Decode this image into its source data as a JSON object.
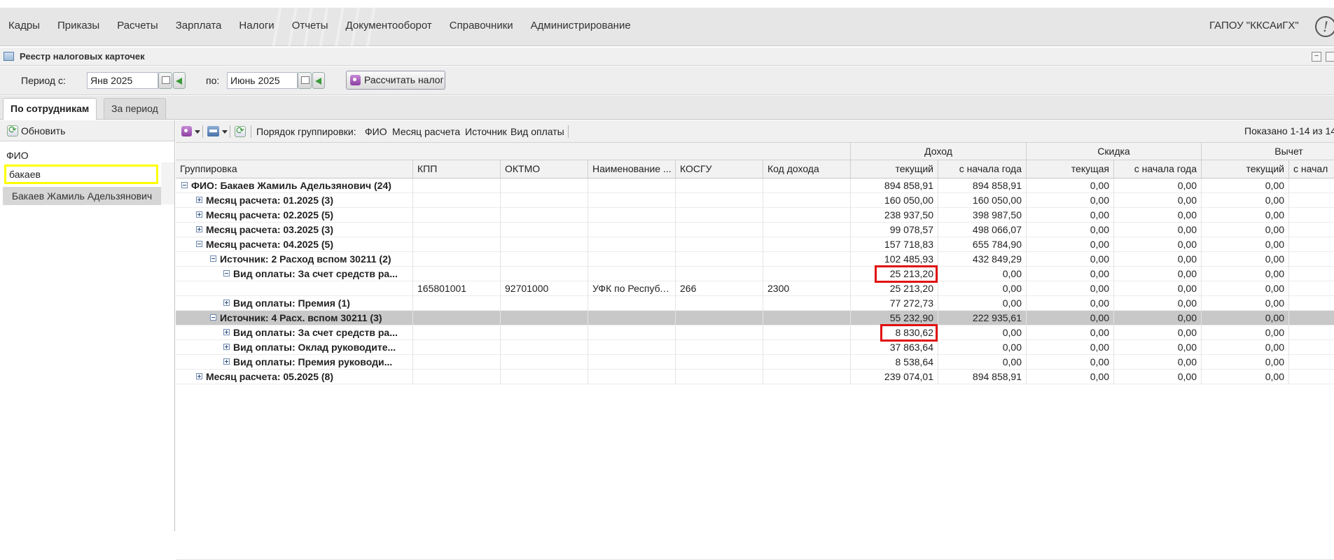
{
  "menu": [
    "Кадры",
    "Приказы",
    "Расчеты",
    "Зарплата",
    "Налоги",
    "Отчеты",
    "Документооборот",
    "Справочники",
    "Администрирование"
  ],
  "org_name": "ГАПОУ \"ККСАиГХ\"",
  "alert_icon": "!",
  "window": {
    "title": "Реестр налоговых карточек",
    "minimize": "–"
  },
  "period": {
    "from_label": "Период с:",
    "from_value": "Янв 2025",
    "to_label": "по:",
    "to_value": "Июнь 2025",
    "calc_button": "Рассчитать налог"
  },
  "tabs": [
    "По сотрудникам",
    "За период"
  ],
  "left": {
    "refresh_label": "Обновить",
    "fio_label": "ФИО",
    "search_value": "бакаев",
    "result": "Бакаев Жамиль Адельзянович"
  },
  "toolbar": {
    "grouping_label": "Порядок группировки:",
    "grouping_items": [
      "ФИО",
      "Месяц расчета",
      "Источник",
      "Вид оплаты"
    ],
    "shown": "Показано 1-14 из 14"
  },
  "header_groups": [
    "Доход",
    "Скидка",
    "Вычет"
  ],
  "columns": [
    "Группировка",
    "КПП",
    "ОКТМО",
    "Наименование ...",
    "КОСГУ",
    "Код дохода",
    "текущий",
    "с начала года",
    "текущая",
    "с начала года",
    "текущий",
    "с начал"
  ],
  "rows": [
    {
      "group": "ФИО: Бакаев Жамиль Адельзянович (24)",
      "level": 0,
      "expander": "minus",
      "bold": true,
      "kpp": "",
      "oktmo": "",
      "name": "",
      "kosgu": "",
      "code": "",
      "inc_cur": "894 858,91",
      "inc_ytd": "894 858,91",
      "disc_cur": "0,00",
      "disc_ytd": "0,00",
      "ded_cur": "0,00"
    },
    {
      "group": "Месяц расчета: 01.2025 (3)",
      "level": 1,
      "expander": "plus",
      "bold": true,
      "kpp": "",
      "oktmo": "",
      "name": "",
      "kosgu": "",
      "code": "",
      "inc_cur": "160 050,00",
      "inc_ytd": "160 050,00",
      "disc_cur": "0,00",
      "disc_ytd": "0,00",
      "ded_cur": "0,00"
    },
    {
      "group": "Месяц расчета: 02.2025 (5)",
      "level": 1,
      "expander": "plus",
      "bold": true,
      "kpp": "",
      "oktmo": "",
      "name": "",
      "kosgu": "",
      "code": "",
      "inc_cur": "238 937,50",
      "inc_ytd": "398 987,50",
      "disc_cur": "0,00",
      "disc_ytd": "0,00",
      "ded_cur": "0,00"
    },
    {
      "group": "Месяц расчета: 03.2025 (3)",
      "level": 1,
      "expander": "plus",
      "bold": true,
      "kpp": "",
      "oktmo": "",
      "name": "",
      "kosgu": "",
      "code": "",
      "inc_cur": "99 078,57",
      "inc_ytd": "498 066,07",
      "disc_cur": "0,00",
      "disc_ytd": "0,00",
      "ded_cur": "0,00"
    },
    {
      "group": "Месяц расчета: 04.2025 (5)",
      "level": 1,
      "expander": "minus",
      "bold": true,
      "kpp": "",
      "oktmo": "",
      "name": "",
      "kosgu": "",
      "code": "",
      "inc_cur": "157 718,83",
      "inc_ytd": "655 784,90",
      "disc_cur": "0,00",
      "disc_ytd": "0,00",
      "ded_cur": "0,00"
    },
    {
      "group": "Источник: 2 Расход вспом 30211 (2)",
      "level": 2,
      "expander": "minus",
      "bold": true,
      "kpp": "",
      "oktmo": "",
      "name": "",
      "kosgu": "",
      "code": "",
      "inc_cur": "102 485,93",
      "inc_ytd": "432 849,29",
      "disc_cur": "0,00",
      "disc_ytd": "0,00",
      "ded_cur": "0,00"
    },
    {
      "group": "Вид оплаты: За счет средств ра...",
      "level": 3,
      "expander": "minus",
      "bold": true,
      "kpp": "",
      "oktmo": "",
      "name": "",
      "kosgu": "",
      "code": "",
      "inc_cur": "25 213,20",
      "inc_ytd": "0,00",
      "disc_cur": "0,00",
      "disc_ytd": "0,00",
      "ded_cur": "0,00"
    },
    {
      "group": "",
      "level": 4,
      "expander": "",
      "bold": false,
      "kpp": "165801001",
      "oktmo": "92701000",
      "name": "УФК по Республ...",
      "kosgu": "266",
      "code": "2300",
      "inc_cur": "25 213,20",
      "inc_ytd": "0,00",
      "disc_cur": "0,00",
      "disc_ytd": "0,00",
      "ded_cur": "0,00"
    },
    {
      "group": "Вид оплаты: Премия (1)",
      "level": 3,
      "expander": "plus",
      "bold": true,
      "kpp": "",
      "oktmo": "",
      "name": "",
      "kosgu": "",
      "code": "",
      "inc_cur": "77 272,73",
      "inc_ytd": "0,00",
      "disc_cur": "0,00",
      "disc_ytd": "0,00",
      "ded_cur": "0,00"
    },
    {
      "group": "Источник: 4 Расх. вспом 30211 (3)",
      "level": 2,
      "expander": "minus",
      "bold": true,
      "kpp": "",
      "oktmo": "",
      "name": "",
      "kosgu": "",
      "code": "",
      "inc_cur": "55 232,90",
      "inc_ytd": "222 935,61",
      "disc_cur": "0,00",
      "disc_ytd": "0,00",
      "ded_cur": "0,00"
    },
    {
      "group": "Вид оплаты: За счет средств ра...",
      "level": 3,
      "expander": "plus",
      "bold": true,
      "kpp": "",
      "oktmo": "",
      "name": "",
      "kosgu": "",
      "code": "",
      "inc_cur": "8 830,62",
      "inc_ytd": "0,00",
      "disc_cur": "0,00",
      "disc_ytd": "0,00",
      "ded_cur": "0,00"
    },
    {
      "group": "Вид оплаты: Оклад руководите...",
      "level": 3,
      "expander": "plus",
      "bold": true,
      "kpp": "",
      "oktmo": "",
      "name": "",
      "kosgu": "",
      "code": "",
      "inc_cur": "37 863,64",
      "inc_ytd": "0,00",
      "disc_cur": "0,00",
      "disc_ytd": "0,00",
      "ded_cur": "0,00"
    },
    {
      "group": "Вид оплаты: Премия руководи...",
      "level": 3,
      "expander": "plus",
      "bold": true,
      "kpp": "",
      "oktmo": "",
      "name": "",
      "kosgu": "",
      "code": "",
      "inc_cur": "8 538,64",
      "inc_ytd": "0,00",
      "disc_cur": "0,00",
      "disc_ytd": "0,00",
      "ded_cur": "0,00"
    },
    {
      "group": "Месяц расчета: 05.2025 (8)",
      "level": 1,
      "expander": "plus",
      "bold": true,
      "kpp": "",
      "oktmo": "",
      "name": "",
      "kosgu": "",
      "code": "",
      "inc_cur": "239 074,01",
      "inc_ytd": "894 858,91",
      "disc_cur": "0,00",
      "disc_ytd": "0,00",
      "ded_cur": "0,00"
    }
  ],
  "selected_row": 9,
  "highlighted_rows": [
    6,
    10
  ]
}
